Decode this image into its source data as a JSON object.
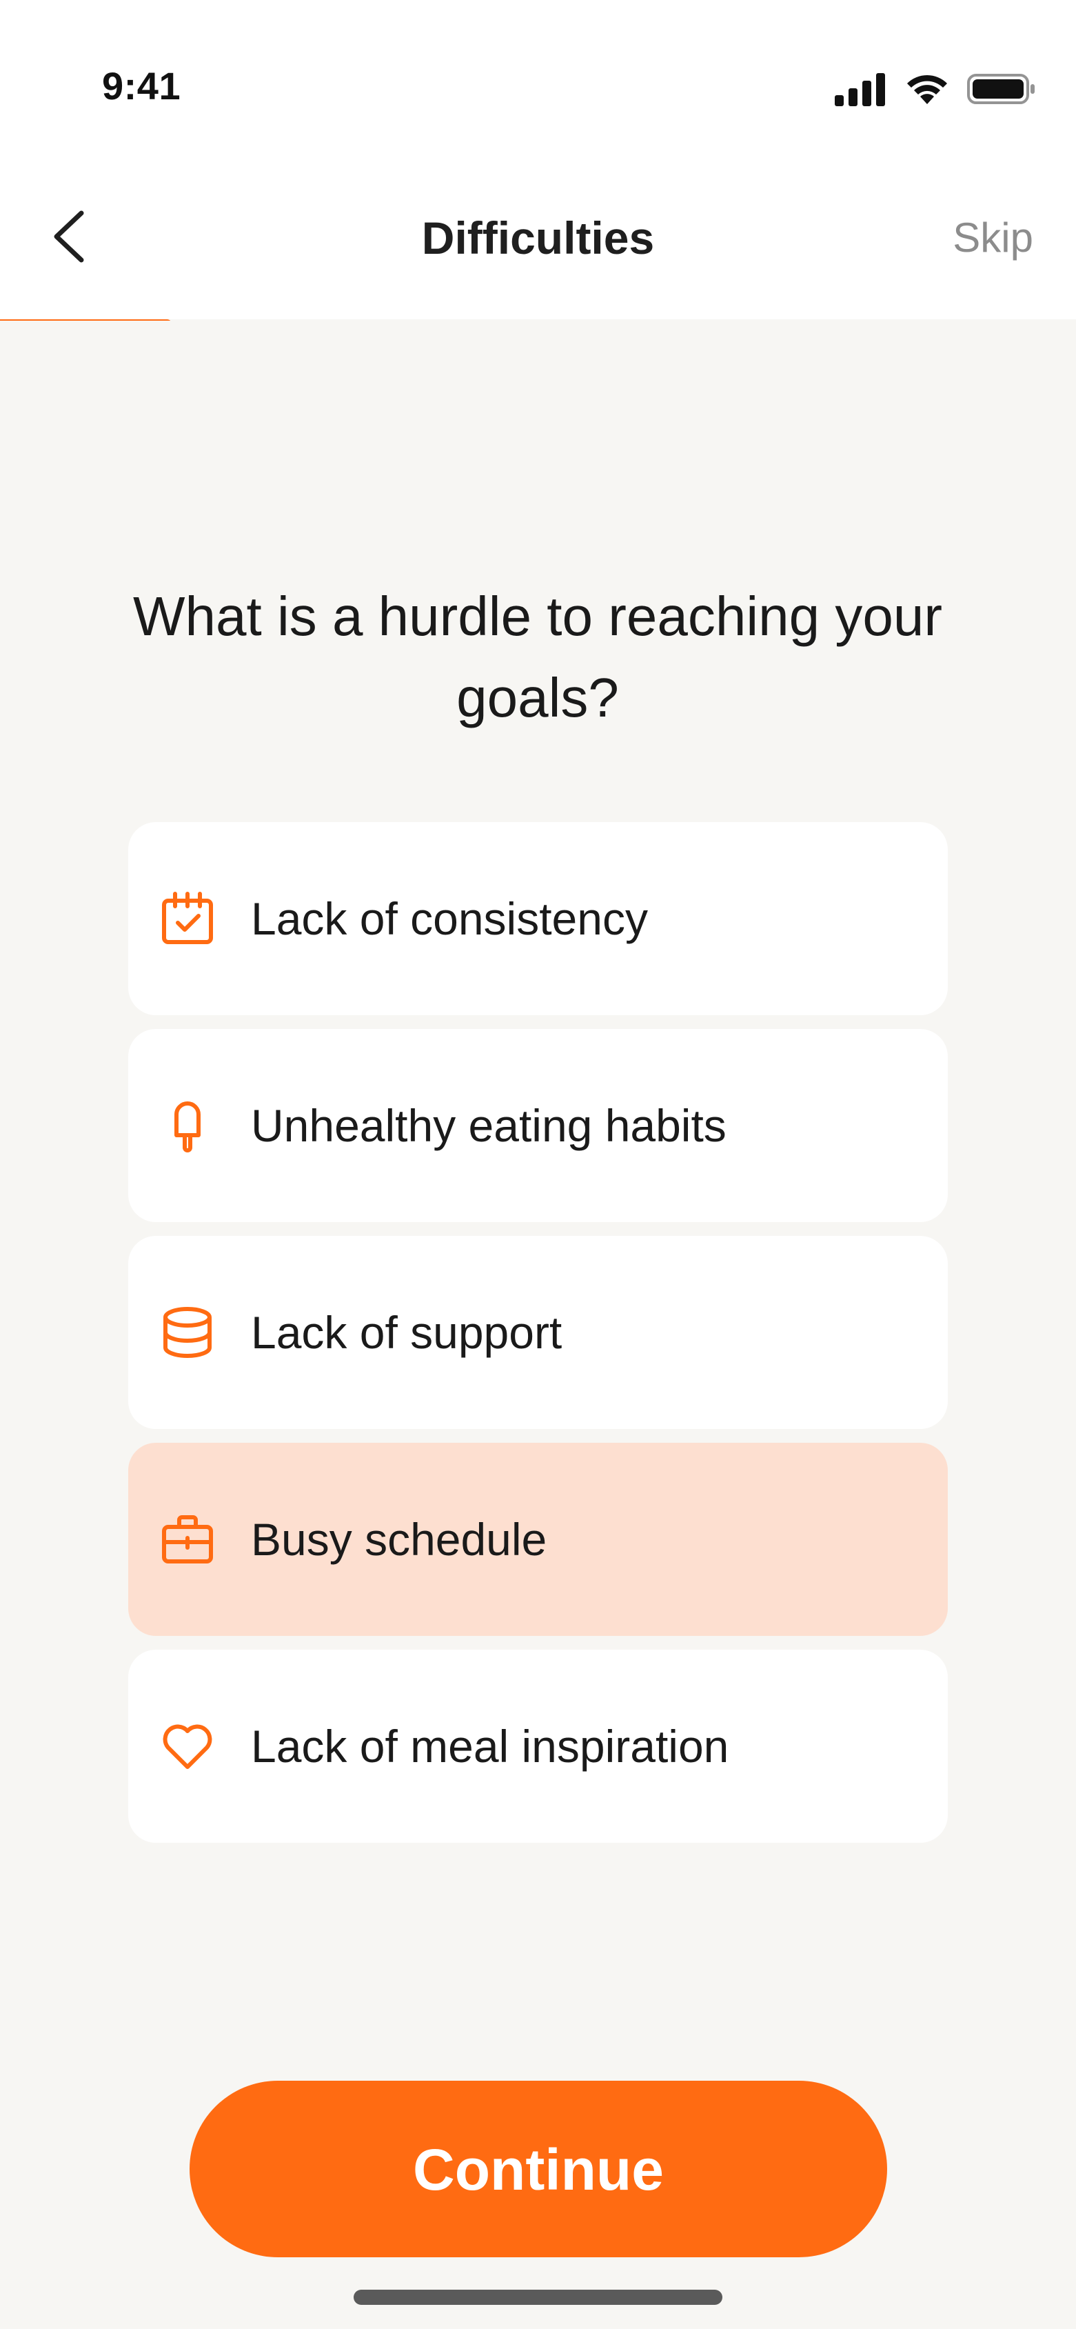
{
  "status_bar": {
    "time": "9:41",
    "icons": [
      "cellular-signal-icon",
      "wifi-icon",
      "battery-icon"
    ]
  },
  "nav": {
    "title": "Difficulties",
    "skip_label": "Skip",
    "back_icon": "chevron-left-icon"
  },
  "progress": {
    "fraction": 0.16,
    "color": "#ff6b12"
  },
  "question": "What is a hurdle to reaching your goals?",
  "options": [
    {
      "label": "Lack of consistency",
      "icon": "calendar-check-icon",
      "selected": false
    },
    {
      "label": "Unhealthy eating habits",
      "icon": "popsicle-icon",
      "selected": false
    },
    {
      "label": "Lack of support",
      "icon": "database-icon",
      "selected": false
    },
    {
      "label": "Busy schedule",
      "icon": "briefcase-icon",
      "selected": true
    },
    {
      "label": "Lack of meal inspiration",
      "icon": "heart-icon",
      "selected": false
    }
  ],
  "continue_label": "Continue",
  "colors": {
    "accent": "#ff6b12",
    "selected_bg": "#fddfd0",
    "page_bg": "#f7f6f3",
    "card_bg": "#ffffff",
    "muted_text": "#8c8c8c"
  }
}
